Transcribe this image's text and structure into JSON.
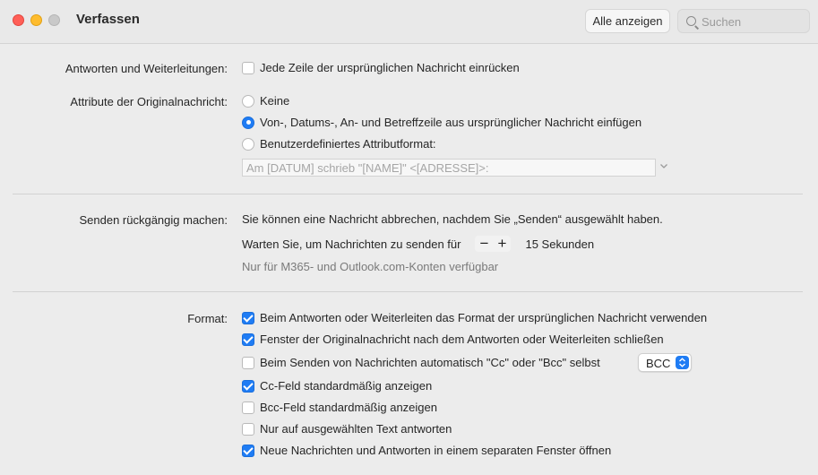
{
  "window": {
    "title": "Verfassen",
    "show_all_label": "Alle anzeigen",
    "search_placeholder": "Suchen"
  },
  "reply_forward": {
    "label": "Antworten und Weiterleitungen:",
    "indent_option": {
      "label": "Jede Zeile der ursprünglichen Nachricht einrücken",
      "checked": false
    }
  },
  "attribution": {
    "label": "Attribute der Originalnachricht:",
    "options": [
      {
        "label": "Keine",
        "selected": false
      },
      {
        "label": "Von-, Datums-, An- und Betreffzeile aus ursprünglicher Nachricht einfügen",
        "selected": true
      },
      {
        "label": "Benutzerdefiniertes Attributformat:",
        "selected": false
      }
    ],
    "custom_format_placeholder": "Am [DATUM] schrieb \"[NAME]\" <[ADRESSE]>:"
  },
  "undo_send": {
    "label": "Senden rückgängig machen:",
    "description": "Sie können eine Nachricht abbrechen, nachdem Sie „Senden“ ausgewählt haben.",
    "wait_label": "Warten Sie, um Nachrichten zu senden für",
    "minus": "−",
    "plus": "+",
    "seconds_value": "15 Sekunden",
    "note": "Nur für M365- und Outlook.com-Konten verfügbar"
  },
  "format": {
    "label": "Format:",
    "options": [
      {
        "label": "Beim Antworten oder Weiterleiten das Format der ursprünglichen Nachricht verwenden",
        "checked": true
      },
      {
        "label": "Fenster der Originalnachricht nach dem Antworten oder Weiterleiten schließen",
        "checked": true
      },
      {
        "label": "Beim Senden von Nachrichten automatisch \"Cc\" oder \"Bcc\" selbst",
        "checked": false
      },
      {
        "label": "Cc-Feld standardmäßig anzeigen",
        "checked": true
      },
      {
        "label": "Bcc-Feld standardmäßig anzeigen",
        "checked": false
      },
      {
        "label": "Nur auf ausgewählten Text antworten",
        "checked": false
      },
      {
        "label": "Neue Nachrichten und Antworten in einem separaten Fenster öffnen",
        "checked": true
      }
    ],
    "self_copy_select_value": "BCC"
  },
  "colors": {
    "accent": "#1f7cf4",
    "background": "#ececec"
  }
}
